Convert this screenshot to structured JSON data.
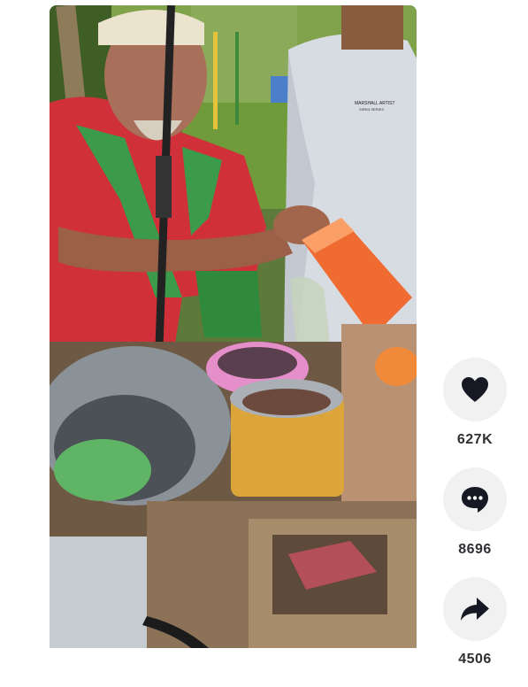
{
  "video": {
    "shirt_print": "MARSHALL ARTIST",
    "shirt_print_sub": "SIREN SERIES"
  },
  "actions": {
    "like": {
      "icon": "heart-icon",
      "count": "627K"
    },
    "comment": {
      "icon": "comment-icon",
      "count": "8696"
    },
    "share": {
      "icon": "share-icon",
      "count": "4506"
    }
  },
  "colors": {
    "action_bg": "#f1f1f2",
    "icon": "#161823",
    "count_text": "#2f2f33"
  }
}
